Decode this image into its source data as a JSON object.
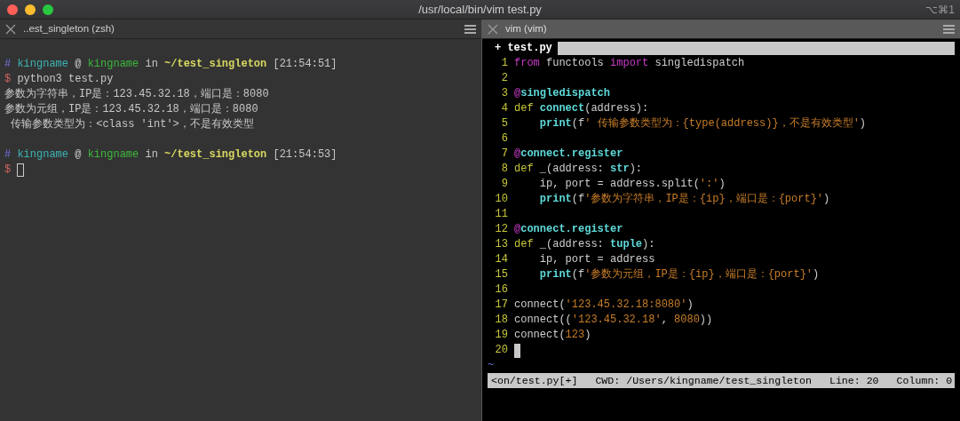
{
  "window": {
    "title": "/usr/local/bin/vim test.py",
    "shortcut": "⌥⌘1"
  },
  "tabs": [
    {
      "label": "..est_singleton (zsh)",
      "selected": false
    },
    {
      "label": "vim (vim)",
      "selected": true
    }
  ],
  "terminal": {
    "sessions": [
      {
        "lines": [
          {
            "segments": [
              {
                "kind": "hash",
                "text": "#"
              },
              {
                "kind": "user",
                "text": " kingname"
              },
              {
                "kind": "plain",
                "text": " @ "
              },
              {
                "kind": "host",
                "text": "kingname"
              },
              {
                "kind": "plain",
                "text": " in "
              },
              {
                "kind": "path",
                "text": "~/test_singleton"
              },
              {
                "kind": "plain",
                "text": " [21:54:51]"
              }
            ]
          },
          {
            "segments": [
              {
                "kind": "dollar",
                "text": "$"
              },
              {
                "kind": "plain",
                "text": " python3 test.py"
              }
            ]
          },
          {
            "segments": [
              {
                "kind": "plain",
                "text": "参数为字符串，IP是：123.45.32.18，端口是：8080"
              }
            ]
          },
          {
            "segments": [
              {
                "kind": "plain",
                "text": "参数为元组，IP是：123.45.32.18，端口是：8080"
              }
            ]
          },
          {
            "segments": [
              {
                "kind": "plain",
                "text": " 传输参数类型为：<class 'int'>，不是有效类型"
              }
            ]
          }
        ]
      },
      {
        "lines": [
          {
            "segments": [
              {
                "kind": "hash",
                "text": "#"
              },
              {
                "kind": "user",
                "text": " kingname"
              },
              {
                "kind": "plain",
                "text": " @ "
              },
              {
                "kind": "host",
                "text": "kingname"
              },
              {
                "kind": "plain",
                "text": " in "
              },
              {
                "kind": "path",
                "text": "~/test_singleton"
              },
              {
                "kind": "plain",
                "text": " [21:54:53]"
              }
            ]
          },
          {
            "segments": [
              {
                "kind": "dollar",
                "text": "$"
              }
            ],
            "cursor": true
          }
        ]
      }
    ]
  },
  "vim": {
    "tabline": {
      "label": "+ test.py"
    },
    "lines": [
      {
        "number": "1",
        "tokens": [
          {
            "kind": "keyword",
            "text": "from"
          },
          {
            "kind": "plain",
            "text": " functools "
          },
          {
            "kind": "keyword",
            "text": "import"
          },
          {
            "kind": "plain",
            "text": " singledispatch"
          }
        ]
      },
      {
        "number": "2"
      },
      {
        "number": "3",
        "tokens": [
          {
            "kind": "keyword",
            "text": "@"
          },
          {
            "kind": "decorator",
            "text": "singledispatch"
          }
        ]
      },
      {
        "number": "4",
        "tokens": [
          {
            "kind": "def",
            "text": "def"
          },
          {
            "kind": "func",
            "text": " connect"
          },
          {
            "kind": "plain",
            "text": "(address):"
          }
        ]
      },
      {
        "number": "5",
        "tokens": [
          {
            "kind": "builtin",
            "text": "    print"
          },
          {
            "kind": "plain",
            "text": "(f"
          },
          {
            "kind": "string",
            "text": "' 传输参数类型为：{type(address)}，不是有效类型'"
          },
          {
            "kind": "plain",
            "text": ")"
          }
        ]
      },
      {
        "number": "6"
      },
      {
        "number": "7",
        "tokens": [
          {
            "kind": "keyword",
            "text": "@"
          },
          {
            "kind": "decorator",
            "text": "connect.register"
          }
        ]
      },
      {
        "number": "8",
        "tokens": [
          {
            "kind": "def",
            "text": "def"
          },
          {
            "kind": "plain",
            "text": " _(address: "
          },
          {
            "kind": "builtin",
            "text": "str"
          },
          {
            "kind": "plain",
            "text": "):"
          }
        ]
      },
      {
        "number": "9",
        "tokens": [
          {
            "kind": "plain",
            "text": "    ip, port = address.split("
          },
          {
            "kind": "string",
            "text": "':'"
          },
          {
            "kind": "plain",
            "text": ")"
          }
        ]
      },
      {
        "number": "10",
        "tokens": [
          {
            "kind": "builtin",
            "text": "    print"
          },
          {
            "kind": "plain",
            "text": "(f"
          },
          {
            "kind": "string",
            "text": "'参数为字符串，IP是：{ip}，端口是：{port}'"
          },
          {
            "kind": "plain",
            "text": ")"
          }
        ]
      },
      {
        "number": "11"
      },
      {
        "number": "12",
        "tokens": [
          {
            "kind": "keyword",
            "text": "@"
          },
          {
            "kind": "decorator",
            "text": "connect.register"
          }
        ]
      },
      {
        "number": "13",
        "tokens": [
          {
            "kind": "def",
            "text": "def"
          },
          {
            "kind": "plain",
            "text": " _(address: "
          },
          {
            "kind": "builtin",
            "text": "tuple"
          },
          {
            "kind": "plain",
            "text": "):"
          }
        ]
      },
      {
        "number": "14",
        "tokens": [
          {
            "kind": "plain",
            "text": "    ip, port = address"
          }
        ]
      },
      {
        "number": "15",
        "tokens": [
          {
            "kind": "builtin",
            "text": "    print"
          },
          {
            "kind": "plain",
            "text": "(f"
          },
          {
            "kind": "string",
            "text": "'参数为元组，IP是：{ip}，端口是：{port}'"
          },
          {
            "kind": "plain",
            "text": ")"
          }
        ]
      },
      {
        "number": "16"
      },
      {
        "number": "17",
        "tokens": [
          {
            "kind": "plain",
            "text": "connect("
          },
          {
            "kind": "string",
            "text": "'123.45.32.18:8080'"
          },
          {
            "kind": "plain",
            "text": ")"
          }
        ]
      },
      {
        "number": "18",
        "tokens": [
          {
            "kind": "plain",
            "text": "connect(("
          },
          {
            "kind": "string",
            "text": "'123.45.32.18'"
          },
          {
            "kind": "plain",
            "text": ", "
          },
          {
            "kind": "string",
            "text": "8080"
          },
          {
            "kind": "plain",
            "text": "))"
          }
        ]
      },
      {
        "number": "19",
        "tokens": [
          {
            "kind": "plain",
            "text": "connect("
          },
          {
            "kind": "string",
            "text": "123"
          },
          {
            "kind": "plain",
            "text": ")"
          }
        ]
      },
      {
        "number": "20",
        "cursor": true
      }
    ],
    "tilde": "~",
    "status_bar": [
      "<on/test.py[+]",
      "CWD: /Users/kingname/test_singleton",
      "Line: 20",
      "Column: 0"
    ]
  }
}
